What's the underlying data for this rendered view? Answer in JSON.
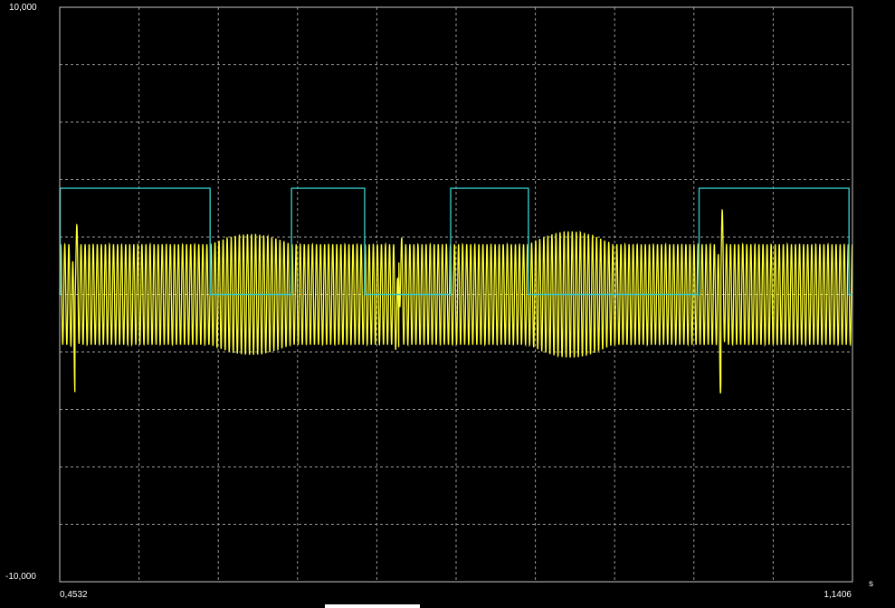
{
  "chart_data": {
    "type": "line",
    "x_unit": "s",
    "ylim": [
      -10,
      10
    ],
    "xlim": [
      0.4532,
      1.1406
    ],
    "y_tick_labels": {
      "max": "10,000",
      "min": "-10,000"
    },
    "x_tick_labels": {
      "min": "0,4532",
      "max": "1,1406"
    },
    "grid": true,
    "grid_divisions": {
      "x": 10,
      "y": 10
    },
    "colors": {
      "background": "#000000",
      "grid": "#9a9a9a",
      "frame": "#c8c8c8",
      "square_wave": "#36c8c8",
      "oscillation": "#ffff33"
    },
    "series": [
      {
        "kind": "square",
        "high": 3.7,
        "low": 0.0,
        "high_intervals": [
          [
            0.4536,
            0.5836
          ],
          [
            0.6542,
            0.7176
          ],
          [
            0.7922,
            0.8596
          ],
          [
            1.0076,
            1.1376
          ]
        ]
      },
      {
        "kind": "oscillation",
        "offset": 0.0,
        "base_amplitude": 1.75,
        "amplitude_segments": [
          {
            "x0": 0.4532,
            "x1": 0.5836,
            "amplitude": 1.75
          },
          {
            "x0": 0.5836,
            "x1": 0.6542,
            "amplitude": 2.1
          },
          {
            "x0": 0.6542,
            "x1": 0.7176,
            "amplitude": 1.75
          },
          {
            "x0": 0.7176,
            "x1": 0.7922,
            "amplitude": 1.75
          },
          {
            "x0": 0.7922,
            "x1": 0.8596,
            "amplitude": 1.75
          },
          {
            "x0": 0.8596,
            "x1": 0.9326,
            "amplitude": 2.2
          },
          {
            "x0": 0.9326,
            "x1": 1.0076,
            "amplitude": 1.75
          },
          {
            "x0": 1.0076,
            "x1": 1.1406,
            "amplitude": 1.75
          }
        ],
        "transients": [
          {
            "x": 0.4664,
            "peak": 3.0,
            "trough": -3.0
          },
          {
            "x": 0.7472,
            "peak": 3.0,
            "trough": -3.0
          },
          {
            "x": 1.0266,
            "peak": 3.3,
            "trough": -3.3
          }
        ],
        "cycle_period": 0.00352
      }
    ]
  }
}
